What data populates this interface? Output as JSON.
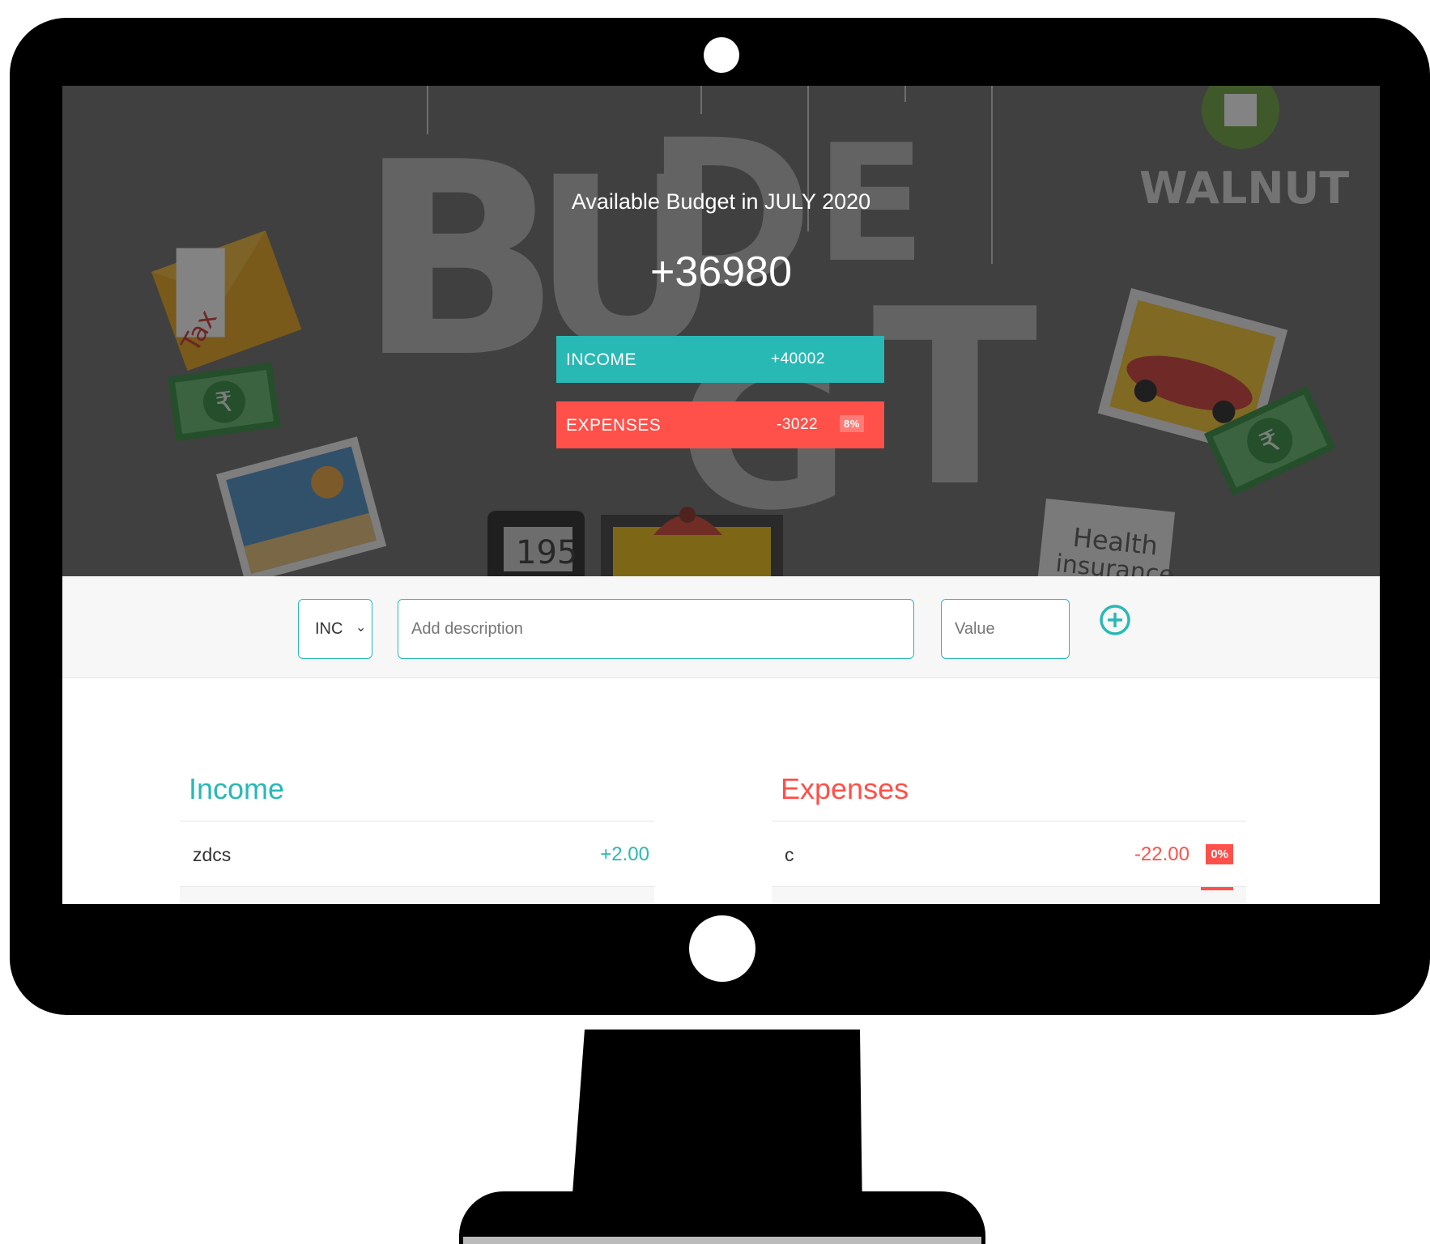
{
  "colors": {
    "income": "#28b9b5",
    "expenses": "#ff5049",
    "frame": "#000000"
  },
  "hero": {
    "title": "Available Budget in JULY 2020",
    "budget": "+36980",
    "art_text": {
      "logo": "WALNUT",
      "tax": "Tax",
      "meter": "195",
      "insurance_1": "Health",
      "insurance_2": "insurance"
    },
    "income": {
      "label": "INCOME",
      "value": "+40002"
    },
    "expenses": {
      "label": "EXPENSES",
      "value": "-3022",
      "percentage": "8%"
    }
  },
  "add_form": {
    "type_selected": "INC",
    "description_placeholder": "Add description",
    "value_placeholder": "Value",
    "add_icon": "plus-circle-icon"
  },
  "income_list": {
    "title": "Income",
    "items": [
      {
        "description": "zdcs",
        "value": "+2.00"
      }
    ]
  },
  "expenses_list": {
    "title": "Expenses",
    "items": [
      {
        "description": "c",
        "value": "-22.00",
        "percentage": "0%"
      }
    ]
  }
}
